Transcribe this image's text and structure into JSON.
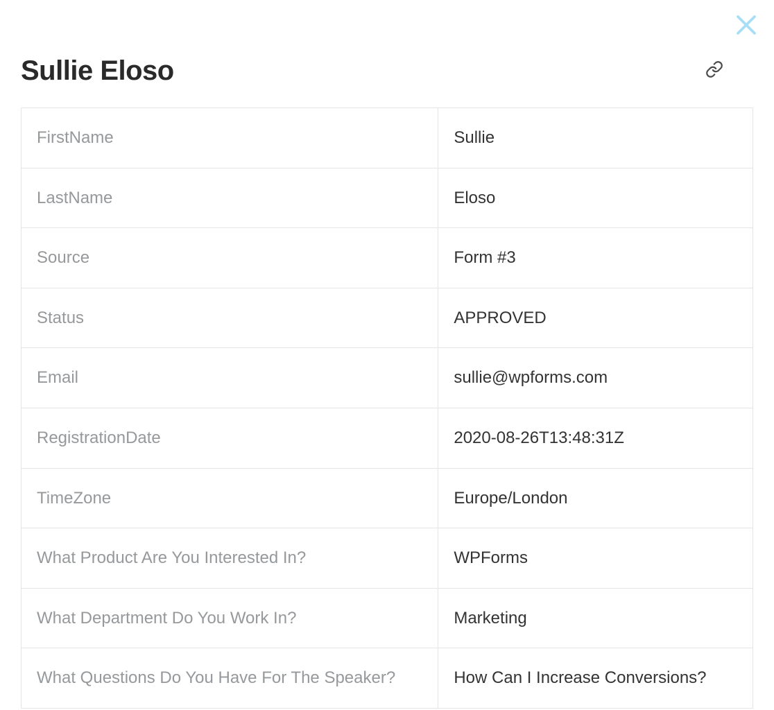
{
  "title": "Sullie Eloso",
  "rows": [
    {
      "label": "FirstName",
      "value": "Sullie"
    },
    {
      "label": "LastName",
      "value": "Eloso"
    },
    {
      "label": "Source",
      "value": "Form #3"
    },
    {
      "label": "Status",
      "value": "APPROVED"
    },
    {
      "label": "Email",
      "value": "sullie@wpforms.com"
    },
    {
      "label": "RegistrationDate",
      "value": "2020-08-26T13:48:31Z"
    },
    {
      "label": "TimeZone",
      "value": "Europe/London"
    },
    {
      "label": "What Product Are You Interested In?",
      "value": "WPForms"
    },
    {
      "label": "What Department Do You Work In?",
      "value": "Marketing"
    },
    {
      "label": "What Questions Do You Have For The Speaker?",
      "value": "How Can I Increase Conversions?"
    }
  ]
}
